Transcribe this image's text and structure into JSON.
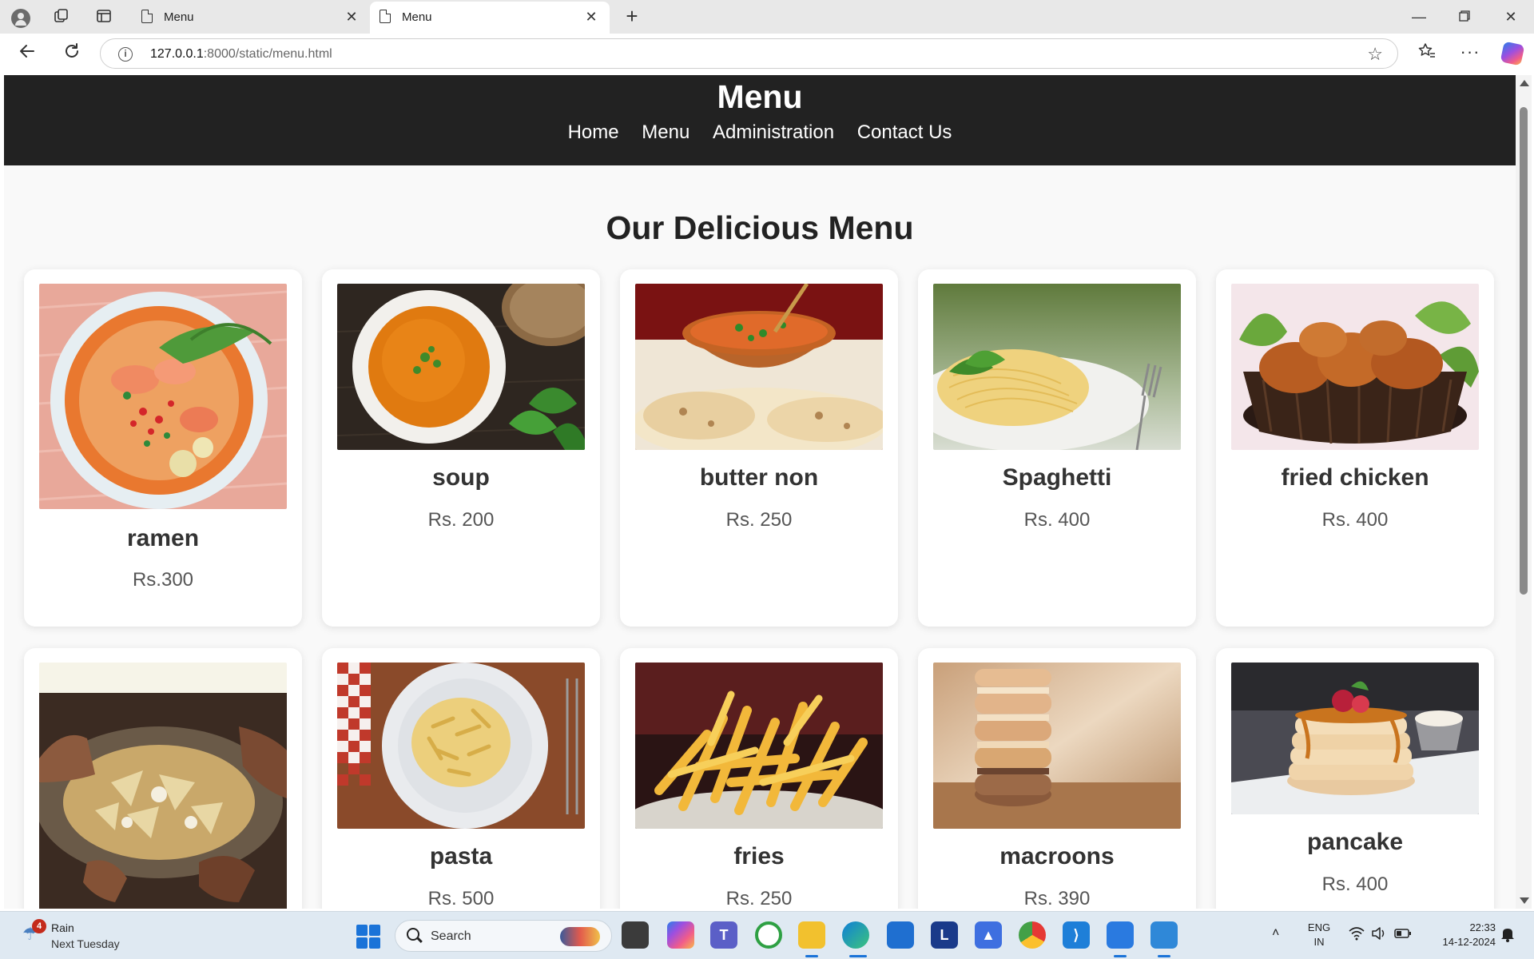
{
  "browser": {
    "tabs": [
      {
        "title": "Menu",
        "active": false
      },
      {
        "title": "Menu",
        "active": true
      }
    ],
    "url_host": "127.0.0.1",
    "url_rest": ":8000/static/menu.html"
  },
  "site": {
    "title": "Menu",
    "nav": [
      "Home",
      "Menu",
      "Administration",
      "Contact Us"
    ],
    "heading": "Our Delicious Menu"
  },
  "menu_items": [
    {
      "name": "ramen",
      "price": "Rs.300"
    },
    {
      "name": "soup",
      "price": "Rs. 200"
    },
    {
      "name": "butter non",
      "price": "Rs. 250"
    },
    {
      "name": "Spaghetti",
      "price": "Rs. 400"
    },
    {
      "name": "fried chicken",
      "price": "Rs. 400"
    },
    {
      "name": "",
      "price": ""
    },
    {
      "name": "pasta",
      "price": "Rs. 500"
    },
    {
      "name": "fries",
      "price": "Rs. 250"
    },
    {
      "name": "macroons",
      "price": "Rs. 390"
    },
    {
      "name": "pancake",
      "price": "Rs. 400"
    }
  ],
  "taskbar": {
    "weather_title": "Rain",
    "weather_sub": "Next Tuesday",
    "weather_badge": "4",
    "search_label": "Search",
    "lang_top": "ENG",
    "lang_bottom": "IN",
    "time": "22:33",
    "date": "14-12-2024"
  },
  "colors": {
    "header_bg": "#222222",
    "page_bg": "#f9f9f9",
    "accent": "#1a73d8"
  },
  "icons": [
    "profile-icon",
    "workspaces-icon",
    "tab-actions-icon",
    "page-icon",
    "close-icon",
    "plus-icon",
    "minimize-icon",
    "restore-icon",
    "back-arrow-icon",
    "reload-icon",
    "info-icon",
    "star-icon",
    "favorites-icon",
    "more-icon",
    "copilot-icon",
    "rain-icon",
    "windows-start-icon",
    "search-icon",
    "wifi-icon",
    "volume-icon",
    "battery-icon",
    "bell-icon"
  ]
}
